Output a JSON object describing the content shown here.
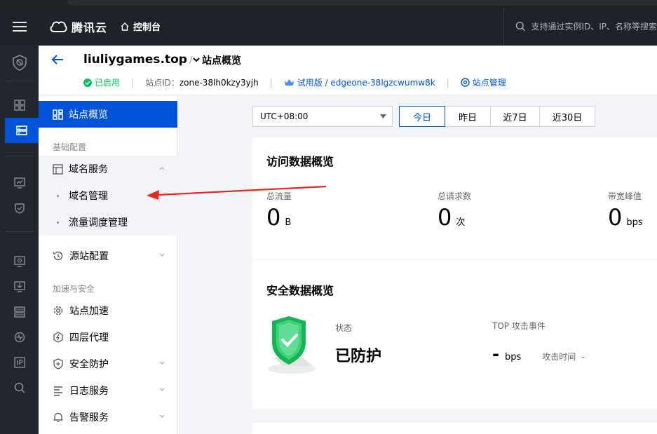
{
  "topbar": {
    "brand": "腾讯云",
    "console": "控制台",
    "search_placeholder": "支持通过实例ID、IP、名称等搜索"
  },
  "header": {
    "site_name": "liuliygames.top",
    "crumb_sep": "/",
    "page_title": "站点概览",
    "status": "已启用",
    "zone_id_label": "站点ID：",
    "zone_id": "zone-38lh0kzy3yjh",
    "plan": "试用版 / edgeone-38lgzcwumw8k",
    "manage": "站点管理",
    "sep": "|"
  },
  "sidenav": {
    "active": "站点概览",
    "group1": "基础配置",
    "domain_service": "域名服务",
    "domain_manage": "域名管理",
    "traffic_manage": "流量调度管理",
    "origin_config": "源站配置",
    "group2": "加速与安全",
    "site_accel": "站点加速",
    "l4_proxy": "四层代理",
    "security": "安全防护",
    "log_service": "日志服务",
    "alert_service": "告警服务"
  },
  "toolbar": {
    "timezone": "UTC+08:00",
    "ranges": [
      "今日",
      "昨日",
      "近7日",
      "近30日"
    ]
  },
  "access_card": {
    "title": "访问数据概览",
    "metrics": [
      {
        "label": "总流量",
        "value": "0",
        "unit": "B"
      },
      {
        "label": "总请求数",
        "value": "0",
        "unit": "次"
      },
      {
        "label": "带宽峰值",
        "value": "0",
        "unit": "bps"
      }
    ]
  },
  "security_card": {
    "title": "安全数据概览",
    "state_label": "状态",
    "state_value": "已防护",
    "top_label": "TOP 攻击事件",
    "top_value": "-",
    "top_unit": "bps",
    "time_label": "攻击时间",
    "time_value": "-"
  },
  "colors": {
    "primary": "#0052d9",
    "success": "#0abf5b",
    "annotation": "#e5281b"
  }
}
